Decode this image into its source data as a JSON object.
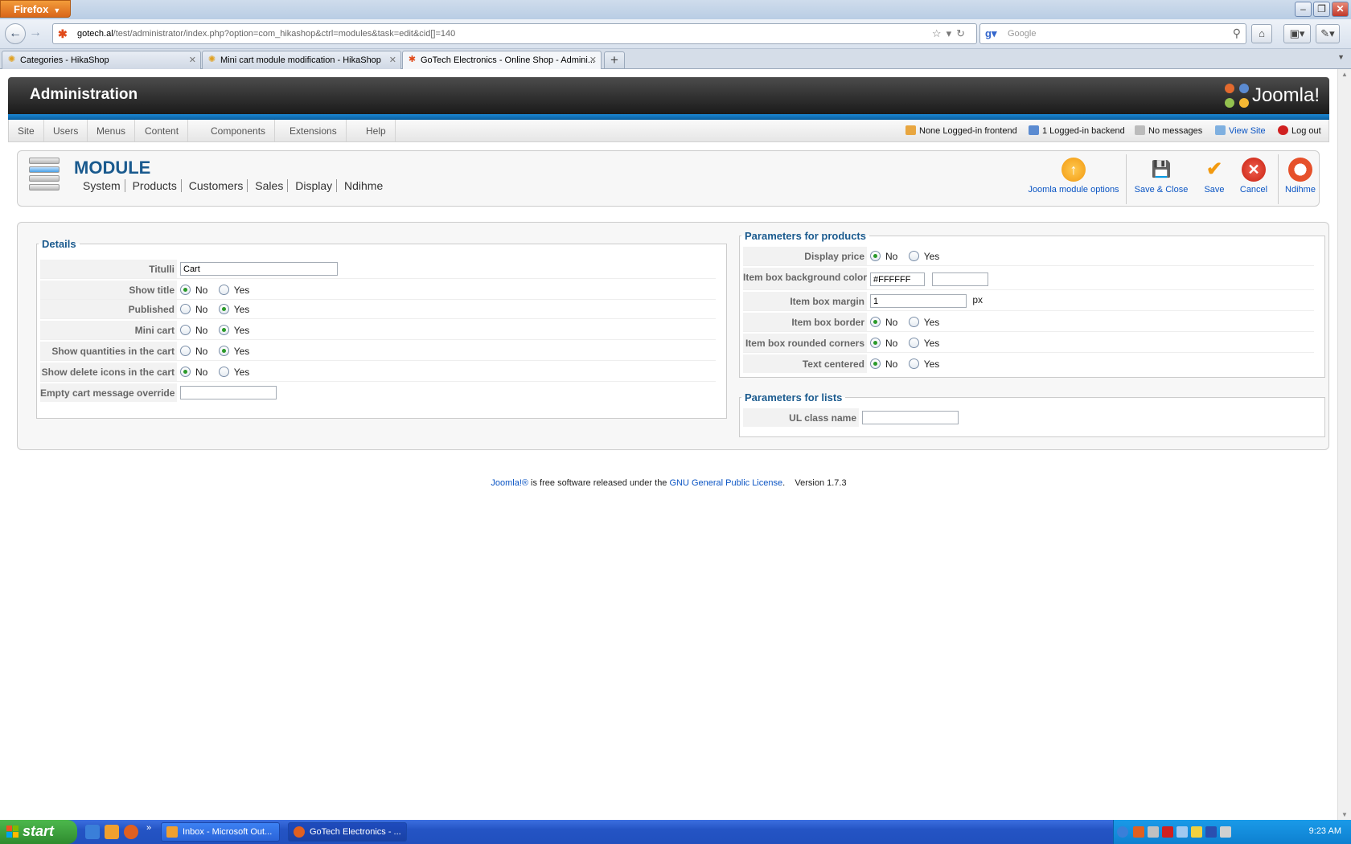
{
  "browser": {
    "app_button": "Firefox",
    "url_domain": "gotech.al",
    "url_path": "/test/administrator/index.php?option=com_hikashop&ctrl=modules&task=edit&cid[]=140",
    "search_placeholder": "Google",
    "tabs": [
      {
        "label": "Categories - HikaShop"
      },
      {
        "label": "Mini cart module modification - HikaShop"
      },
      {
        "label": "GoTech Electronics - Online Shop - Admini..."
      }
    ]
  },
  "header": {
    "title": "Administration",
    "logo_text": "Joomla!"
  },
  "menu": {
    "items": [
      "Site",
      "Users",
      "Menus",
      "Content",
      "Components",
      "Extensions",
      "Help"
    ],
    "status": {
      "frontend": "None Logged-in frontend",
      "backend": "1 Logged-in backend",
      "messages": "No messages",
      "view_site": "View Site",
      "logout": "Log out"
    }
  },
  "toolbar": {
    "title": "MODULE",
    "submenu": [
      "System",
      "Products",
      "Customers",
      "Sales",
      "Display",
      "Ndihme"
    ],
    "buttons": {
      "module_options": "Joomla module options",
      "save_close": "Save & Close",
      "save": "Save",
      "cancel": "Cancel",
      "help": "Ndihme"
    }
  },
  "details": {
    "legend": "Details",
    "titulli_label": "Titulli",
    "titulli_value": "Cart",
    "show_title_label": "Show title",
    "published_label": "Published",
    "mini_cart_label": "Mini cart",
    "show_quantities_label": "Show quantities in the cart",
    "show_delete_label": "Show delete icons in the cart",
    "empty_msg_label": "Empty cart message override",
    "empty_msg_value": "",
    "no": "No",
    "yes": "Yes"
  },
  "products_params": {
    "legend": "Parameters for products",
    "display_price_label": "Display price",
    "bg_color_label": "Item box background color",
    "bg_color_value": "#FFFFFF",
    "margin_label": "Item box margin",
    "margin_value": "1",
    "margin_unit": "px",
    "border_label": "Item box border",
    "rounded_label": "Item box rounded corners",
    "centered_label": "Text centered",
    "no": "No",
    "yes": "Yes"
  },
  "lists_params": {
    "legend": "Parameters for lists",
    "ul_class_label": "UL class name",
    "ul_class_value": ""
  },
  "footer": {
    "joomla_link": "Joomla!®",
    "text": " is free software released under the ",
    "license_link": "GNU General Public License",
    "version": "Version 1.7.3"
  },
  "taskbar": {
    "start": "start",
    "tasks": [
      {
        "label": "Inbox - Microsoft Out..."
      },
      {
        "label": "GoTech Electronics - ..."
      }
    ],
    "clock": "9:23 AM"
  }
}
